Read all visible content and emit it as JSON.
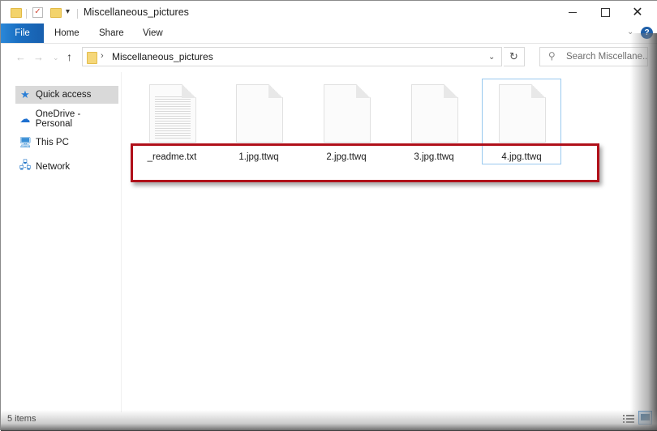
{
  "window": {
    "title": "Miscellaneous_pictures",
    "controls": {
      "minimize": "minimize",
      "maximize": "maximize",
      "close": "✕"
    }
  },
  "quick_access_toolbar": {
    "icons": [
      "folder-icon",
      "properties-check-icon",
      "new-folder-icon"
    ],
    "customize_arrow": "▾"
  },
  "ribbon": {
    "tabs": [
      {
        "label": "File"
      },
      {
        "label": "Home"
      },
      {
        "label": "Share"
      },
      {
        "label": "View"
      }
    ],
    "expand_glyph": "⌄",
    "help_glyph": "?"
  },
  "navigation": {
    "back_glyph": "←",
    "forward_glyph": "→",
    "recent_glyph": "⌄",
    "up_glyph": "↑",
    "breadcrumb_separator": "›",
    "path": "Miscellaneous_pictures",
    "address_dropdown_glyph": "⌄",
    "refresh_glyph": "↻",
    "search_placeholder": "Search Miscellane...",
    "search_glyph": "⚲"
  },
  "sidebar": {
    "items": [
      {
        "label": "Quick access",
        "icon": "star-icon",
        "glyph": "★",
        "selected": true
      },
      {
        "label": "OneDrive - Personal",
        "icon": "cloud-icon",
        "glyph": "☁",
        "selected": false
      },
      {
        "label": "This PC",
        "icon": "computer-icon",
        "glyph": "🖥",
        "selected": false
      },
      {
        "label": "Network",
        "icon": "network-icon",
        "glyph": "🖧",
        "selected": false
      }
    ]
  },
  "files": [
    {
      "name": "_readme.txt",
      "type": "text-document"
    },
    {
      "name": "1.jpg.ttwq",
      "type": "blank-document"
    },
    {
      "name": "2.jpg.ttwq",
      "type": "blank-document"
    },
    {
      "name": "3.jpg.ttwq",
      "type": "blank-document"
    },
    {
      "name": "4.jpg.ttwq",
      "type": "blank-document",
      "focused": true
    }
  ],
  "annotation": {
    "highlight_color": "#b0101a"
  },
  "status_bar": {
    "item_count": "5 items"
  }
}
